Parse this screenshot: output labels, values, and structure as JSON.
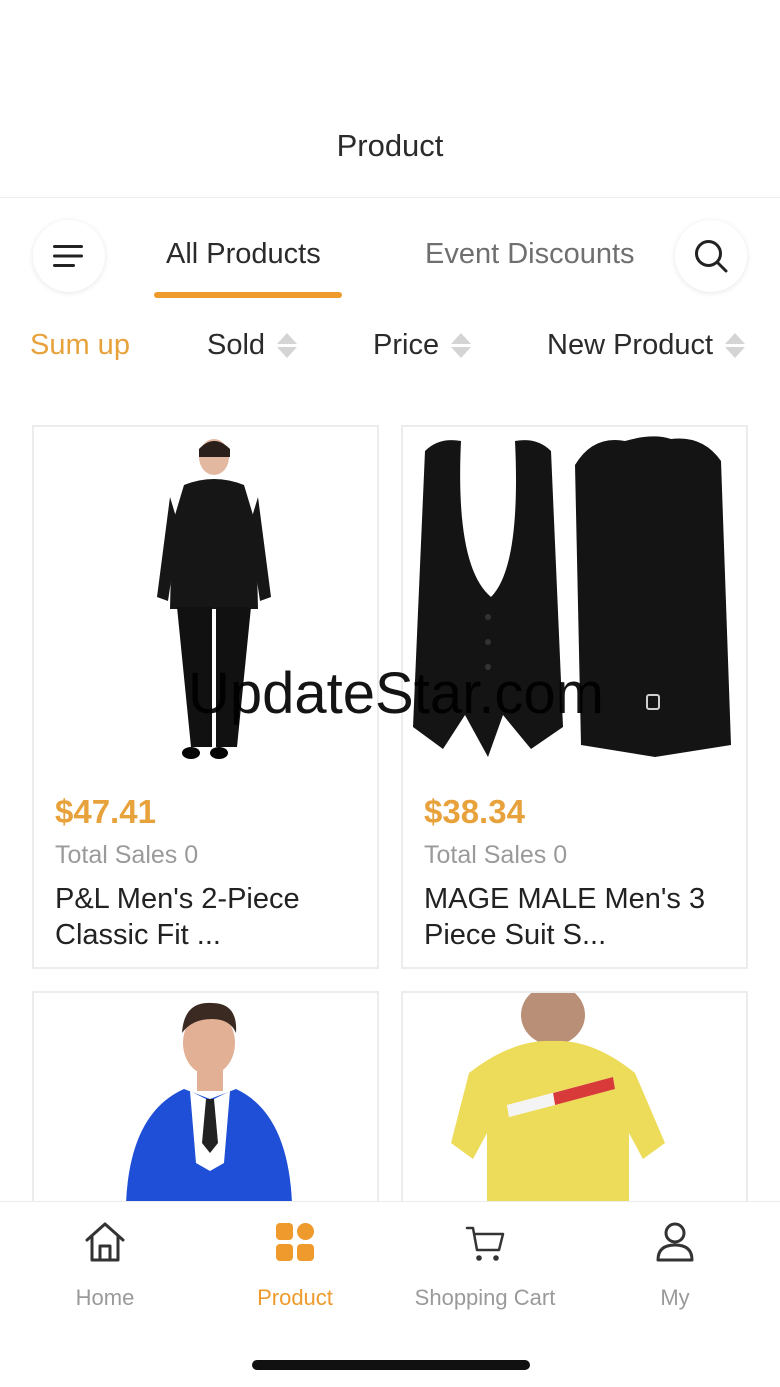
{
  "header": {
    "title": "Product"
  },
  "tabs": [
    {
      "label": "All Products",
      "active": true
    },
    {
      "label": "Event Discounts",
      "active": false
    }
  ],
  "icons": {
    "menu": "menu-lines-icon",
    "search": "search-icon"
  },
  "sort": [
    {
      "label": "Sum up",
      "active": true
    },
    {
      "label": "Sold",
      "active": false
    },
    {
      "label": "Price",
      "active": false
    },
    {
      "label": "New Product",
      "active": false
    }
  ],
  "watermark": "UpdateStar.com",
  "products": [
    {
      "price": "$47.41",
      "sales": "Total Sales 0",
      "name": "P&L Men's 2-Piece Classic Fit ...",
      "image": "black-suit-back-view"
    },
    {
      "price": "$38.34",
      "sales": "Total Sales 0",
      "name": "MAGE MALE Men's 3 Piece Suit S...",
      "image": "black-vest-front-back"
    },
    {
      "image": "blue-suit-man"
    },
    {
      "image": "yellow-tshirt-man"
    }
  ],
  "nav": [
    {
      "label": "Home",
      "icon": "home-icon",
      "active": false
    },
    {
      "label": "Product",
      "icon": "grid-icon",
      "active": true
    },
    {
      "label": "Shopping Cart",
      "icon": "cart-icon",
      "active": false
    },
    {
      "label": "My",
      "icon": "user-icon",
      "active": false
    }
  ],
  "colors": {
    "accent": "#ee9a2c",
    "price": "#e8a23c",
    "muted": "#9a9a9a"
  }
}
